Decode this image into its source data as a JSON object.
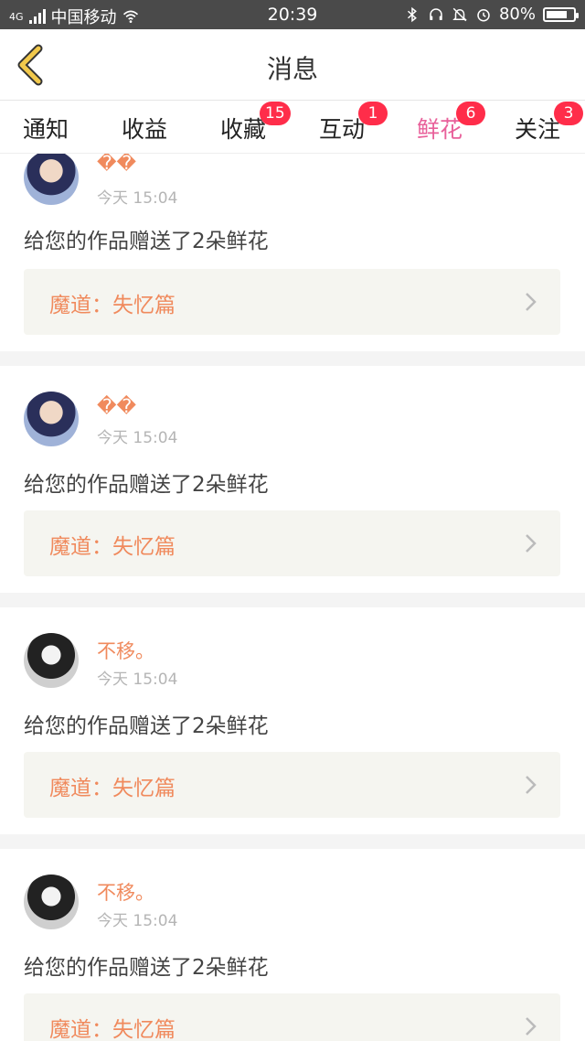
{
  "status_bar": {
    "network": "4G",
    "carrier": "中国移动",
    "time": "20:39",
    "battery": "80%",
    "battery_level": 0.8,
    "icons": [
      "signal-icon",
      "wifi-icon",
      "bluetooth-icon",
      "headset-icon",
      "mute-icon",
      "alarm-icon",
      "battery-icon"
    ]
  },
  "header": {
    "title": "消息",
    "back_icon": "chevron-left-icon",
    "accent_color": "#f2c94c"
  },
  "tabs": [
    {
      "label": "通知",
      "badge": ""
    },
    {
      "label": "收益",
      "badge": ""
    },
    {
      "label": "收藏",
      "badge": "15"
    },
    {
      "label": "互动",
      "badge": "1"
    },
    {
      "label": "鲜花",
      "badge": "6",
      "active": true
    },
    {
      "label": "关注",
      "badge": "3"
    }
  ],
  "colors": {
    "active_tab": "#e8609a",
    "badge": "#ff2d4a",
    "username": "#f08a5d",
    "work_title": "#f08a5d"
  },
  "messages": [
    {
      "user": "��",
      "time": "今天 15:04",
      "text": "给您的作品赠送了2朵鲜花",
      "work": "魔道：失忆篇"
    },
    {
      "user": "��",
      "time": "今天 15:04",
      "text": "给您的作品赠送了2朵鲜花",
      "work": "魔道：失忆篇"
    },
    {
      "user": "不移。",
      "time": "今天 15:04",
      "text": "给您的作品赠送了2朵鲜花",
      "work": "魔道：失忆篇"
    },
    {
      "user": "不移。",
      "time": "今天 15:04",
      "text": "给您的作品赠送了2朵鲜花",
      "work": "魔道：失忆篇"
    }
  ]
}
